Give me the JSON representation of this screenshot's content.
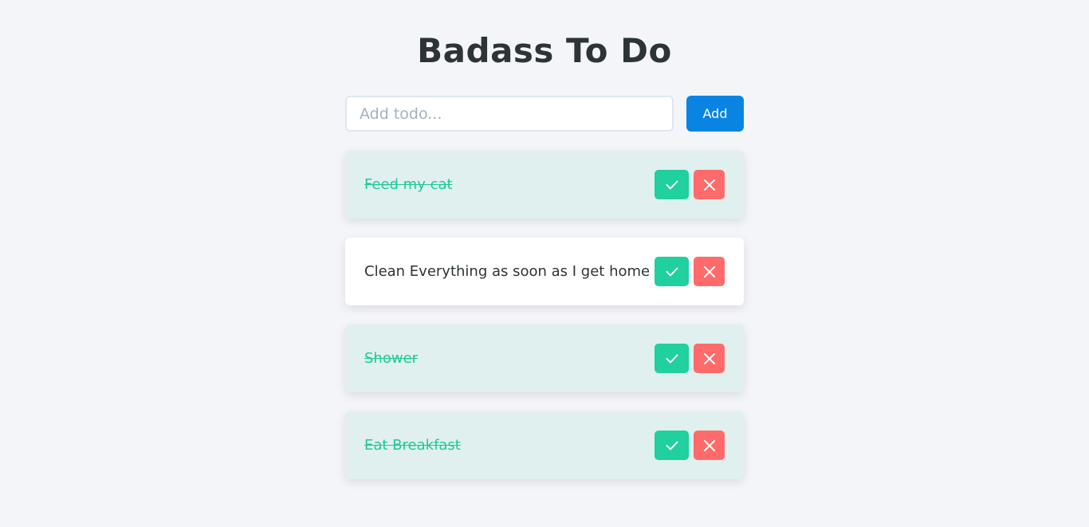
{
  "header": {
    "title": "Badass To Do"
  },
  "add_form": {
    "placeholder": "Add todo...",
    "value": "",
    "button_label": "Add"
  },
  "todos": [
    {
      "text": "Feed my cat",
      "completed": true
    },
    {
      "text": "Clean Everything as soon as I get home",
      "completed": false
    },
    {
      "text": "Shower",
      "completed": true
    },
    {
      "text": "Eat Breakfast",
      "completed": true
    }
  ],
  "icons": {
    "complete": "check-icon",
    "delete": "close-icon"
  },
  "colors": {
    "accent": "#0984e3",
    "complete_button": "#20d09f",
    "delete_button": "#ff6b6b",
    "completed_text": "#20c997",
    "completed_background": "#dff0ef"
  }
}
